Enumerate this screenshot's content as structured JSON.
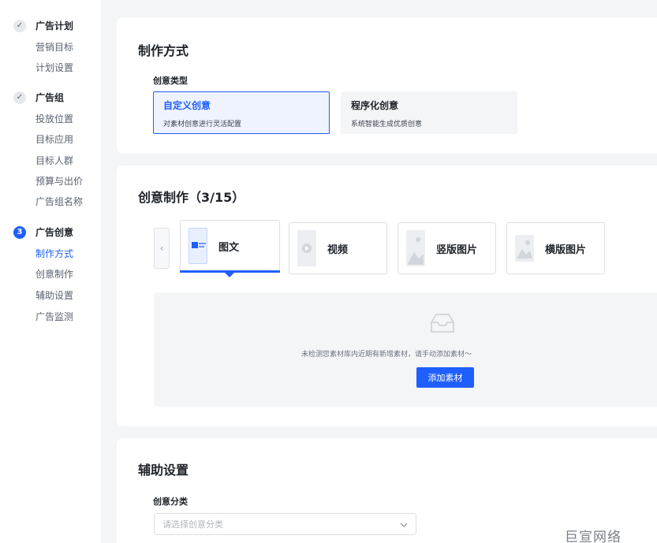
{
  "sidebar": {
    "steps": [
      {
        "indicator": "✓",
        "title": "广告计划",
        "items": [
          "营销目标",
          "计划设置"
        ]
      },
      {
        "indicator": "✓",
        "title": "广告组",
        "items": [
          "投放位置",
          "目标应用",
          "目标人群",
          "预算与出价",
          "广告组名称"
        ]
      },
      {
        "indicator": "3",
        "title": "广告创意",
        "items": [
          "制作方式",
          "创意制作",
          "辅助设置",
          "广告监测"
        ]
      }
    ],
    "active_item": "制作方式"
  },
  "method": {
    "title": "制作方式",
    "field_label": "创意类型",
    "options": [
      {
        "title": "自定义创意",
        "desc": "对素材创意进行灵活配置",
        "selected": true
      },
      {
        "title": "程序化创意",
        "desc": "系统智能生成优质创意",
        "selected": false
      }
    ]
  },
  "creative": {
    "title": "创意制作（3/15）",
    "tabs": [
      {
        "label": "图文",
        "selected": true
      },
      {
        "label": "视频",
        "selected": false
      },
      {
        "label": "竖版图片",
        "selected": false
      },
      {
        "label": "横版图片",
        "selected": false
      }
    ],
    "empty_message": "未检测您素材库内近期有新增素材，请手动添加素材～",
    "add_button": "添加素材"
  },
  "assist": {
    "title": "辅助设置",
    "field_label": "创意分类",
    "select_placeholder": "请选择创意分类"
  },
  "watermark": "巨宣网络",
  "colors": {
    "accent": "#1f5fff",
    "background": "#f4f5f7"
  }
}
